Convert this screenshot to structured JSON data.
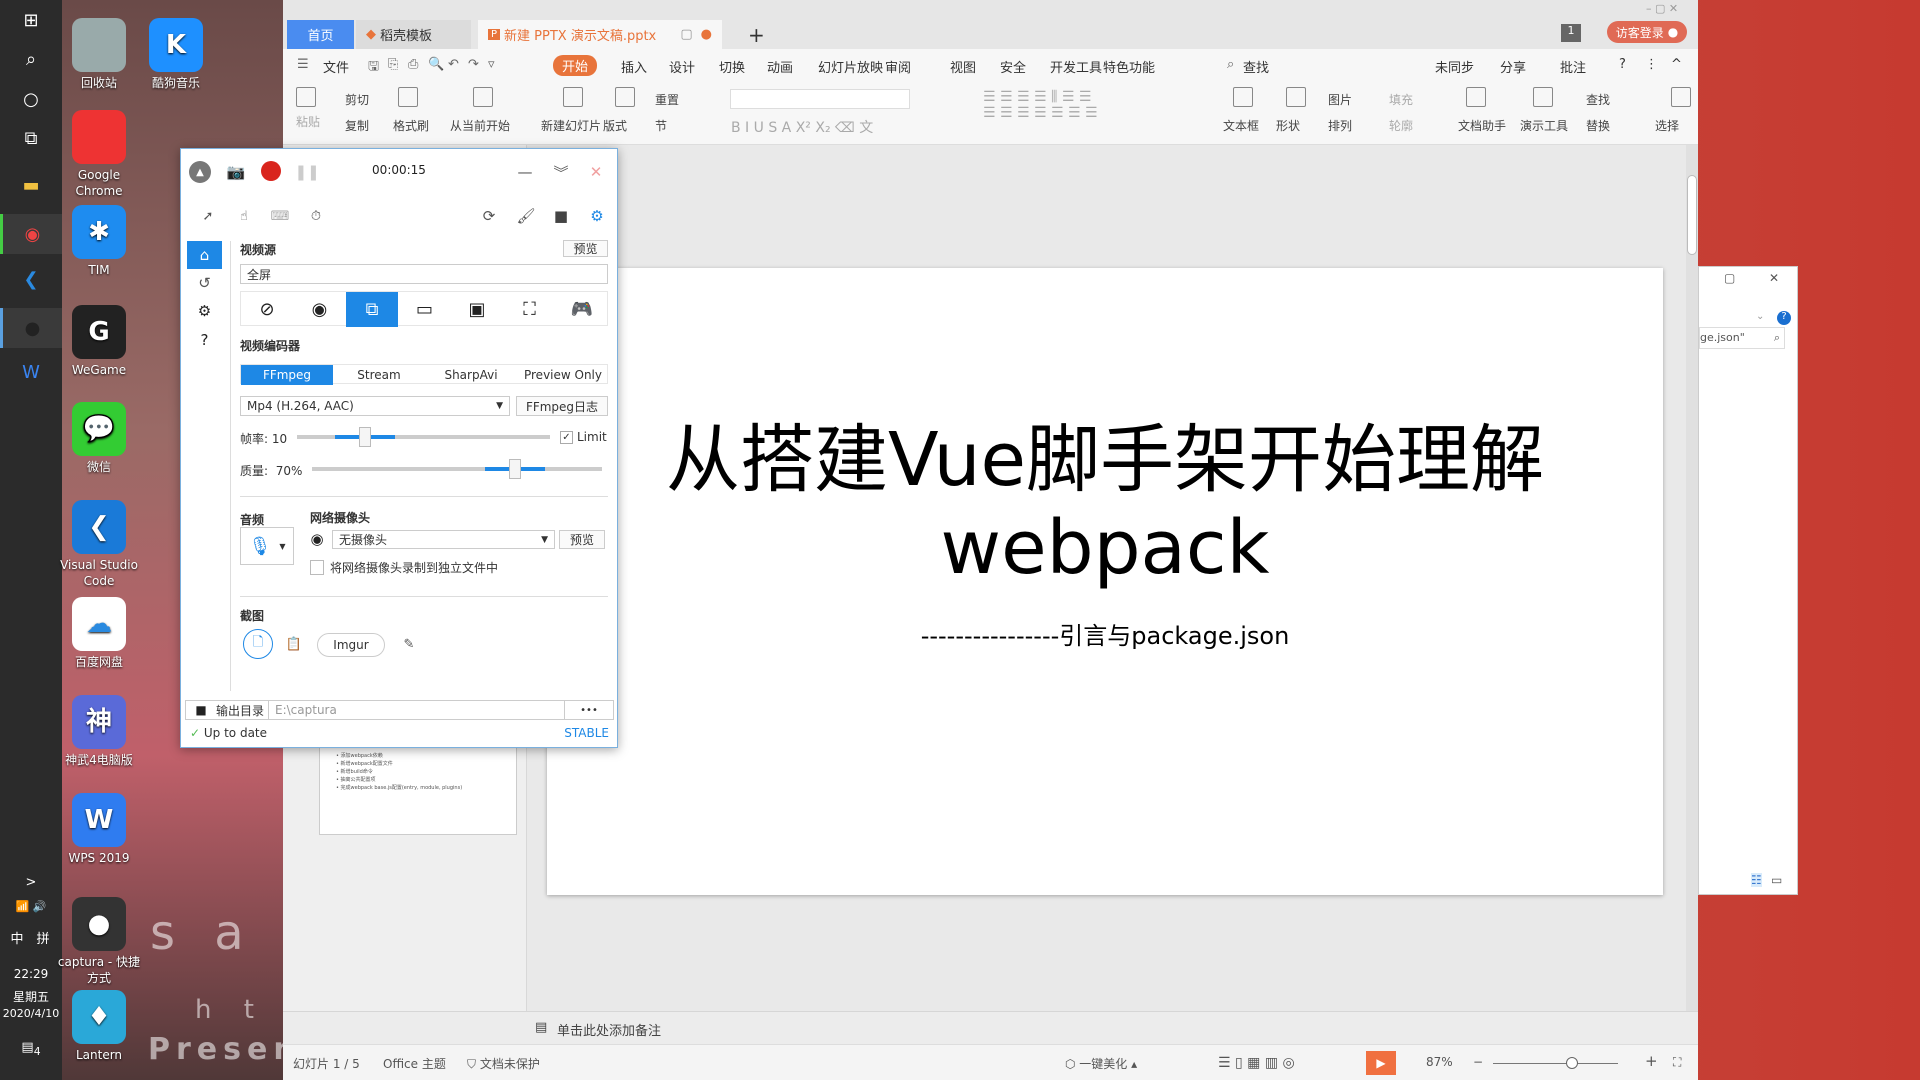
{
  "colors": {
    "accent": "#1e88e5",
    "wps_orange": "#e8743b",
    "record": "#d9251d",
    "wps_tab_blue": "#4a8cf0"
  },
  "wallpaper": {
    "text1": "s a b",
    "text2": "h t t p",
    "text3": "Presen"
  },
  "taskbar": {
    "icons": [
      "windows-icon",
      "search-icon",
      "cortana-icon",
      "task-view-icon",
      "file-explorer-icon",
      "chrome-icon",
      "vscode-icon",
      "captura-icon",
      "wps-icon"
    ],
    "expand": ">",
    "ime_lang": "中",
    "ime_mode": "拼",
    "time": "22:29",
    "weekday": "星期五",
    "date": "2020/4/10",
    "notification_count": "4"
  },
  "desktop": [
    {
      "label": "回收站",
      "icon": "recycle-bin-icon",
      "color": "#9aa"
    },
    {
      "label": "酷狗音乐",
      "icon": "kugou-icon",
      "color": "#1e90ff",
      "glyph": "K"
    },
    {
      "label": "Google Chrome",
      "icon": "chrome-icon",
      "color": "#e33"
    },
    {
      "label": "TIM",
      "icon": "tim-icon",
      "color": "#1e8cf0",
      "glyph": "✱"
    },
    {
      "label": "WeGame",
      "icon": "wegame-icon",
      "color": "#222",
      "glyph": "G"
    },
    {
      "label": "微信",
      "icon": "wechat-icon",
      "color": "#3c3",
      "glyph": "💬"
    },
    {
      "label": "Visual Studio Code",
      "icon": "vscode-icon",
      "color": "#1a7ad8",
      "glyph": "❮"
    },
    {
      "label": "百度网盘",
      "icon": "baidu-netdisk-icon",
      "color": "#fff",
      "glyph": "☁"
    },
    {
      "label": "神武4电脑版",
      "icon": "shenwu-icon",
      "color": "#5a6ad8",
      "glyph": "神"
    },
    {
      "label": "WPS 2019",
      "icon": "wps-icon",
      "color": "#2f7cf0",
      "glyph": "W"
    },
    {
      "label": "captura - 快捷方式",
      "icon": "captura-icon",
      "color": "#333",
      "glyph": "●"
    },
    {
      "label": "Lantern",
      "icon": "lantern-icon",
      "color": "#2aa8d8",
      "glyph": "♦"
    }
  ],
  "wps": {
    "tabs": {
      "home": "首页",
      "templates": "稻壳模板",
      "doc": "新建 PPTX 演示文稿.pptx",
      "add": "+"
    },
    "badge": "1",
    "login": "访客登录",
    "menu": [
      "文件",
      "开始",
      "插入",
      "设计",
      "切换",
      "动画",
      "幻灯片放映",
      "审阅",
      "视图",
      "安全",
      "开发工具",
      "特色功能",
      "查找"
    ],
    "menu_right": [
      "未同步",
      "分享",
      "批注",
      "?",
      "⋮",
      "^"
    ],
    "ribbon": {
      "paste": "粘贴",
      "cut": "剪切",
      "copy": "复制",
      "format_painter": "格式刷",
      "play_from_current": "从当前开始",
      "new_slide": "新建幻灯片",
      "layout": "版式",
      "reset": "重置",
      "section": "节",
      "text_box": "文本框",
      "shape": "形状",
      "picture": "图片",
      "arrange": "排列",
      "fill": "填充",
      "outline": "轮廓",
      "doc_assistant": "文档助手",
      "presentation_tools": "演示工具",
      "find": "查找",
      "replace": "替换",
      "select": "选择"
    },
    "slide": {
      "title_line1": "从搭建Vue脚手架开始理解",
      "title_line2": "webpack",
      "subtitle": "----------------引言与package.json"
    },
    "thumbnail_bullets": [
      "• 添加webpack依赖",
      "• 新增webpack配置文件",
      "• 新增build命令",
      "• 抽离公共配置项",
      "• 完成webpack base.js配置(entry, module, plugins)"
    ],
    "add_slide": "+",
    "notes_placeholder": "单击此处添加备注",
    "status": {
      "slide": "幻灯片 1 / 5",
      "theme": "Office 主题",
      "protect": "文档未保护",
      "beautify": "一键美化",
      "zoom": "87%",
      "zoom_level": 87
    }
  },
  "captura": {
    "timer": "00:00:15",
    "video_source": {
      "label": "视频源",
      "preview": "预览",
      "value": "全屏",
      "sources": [
        "no-video-icon",
        "webcam-icon",
        "fullscreen-icon",
        "screen-icon",
        "window-icon",
        "region-icon",
        "gamepad-icon"
      ],
      "selected": 2
    },
    "encoder": {
      "label": "视频编码器",
      "tabs": [
        "FFmpeg",
        "Stream",
        "SharpAvi",
        "Preview Only"
      ],
      "selected": 0,
      "format": "Mp4 (H.264, AAC)",
      "log_button": "FFmpeg日志"
    },
    "framerate": {
      "label": "帧率:",
      "value": "10",
      "limit": "Limit",
      "limit_checked": true,
      "fraction": 0.27
    },
    "quality": {
      "label": "质量:",
      "value": "70%",
      "fraction": 0.7
    },
    "audio": {
      "label": "音频"
    },
    "webcam": {
      "label": "网络摄像头",
      "value": "无摄像头",
      "preview": "预览",
      "separate": "将网络摄像头录制到独立文件中"
    },
    "screenshot": {
      "label": "截图",
      "imgur": "Imgur"
    },
    "output": {
      "label": "输出目录",
      "path": "E:\\captura",
      "more": "•••"
    },
    "update": {
      "status": "Up to date",
      "channel": "STABLE"
    }
  },
  "explorer": {
    "search_text": "ge.json\""
  }
}
